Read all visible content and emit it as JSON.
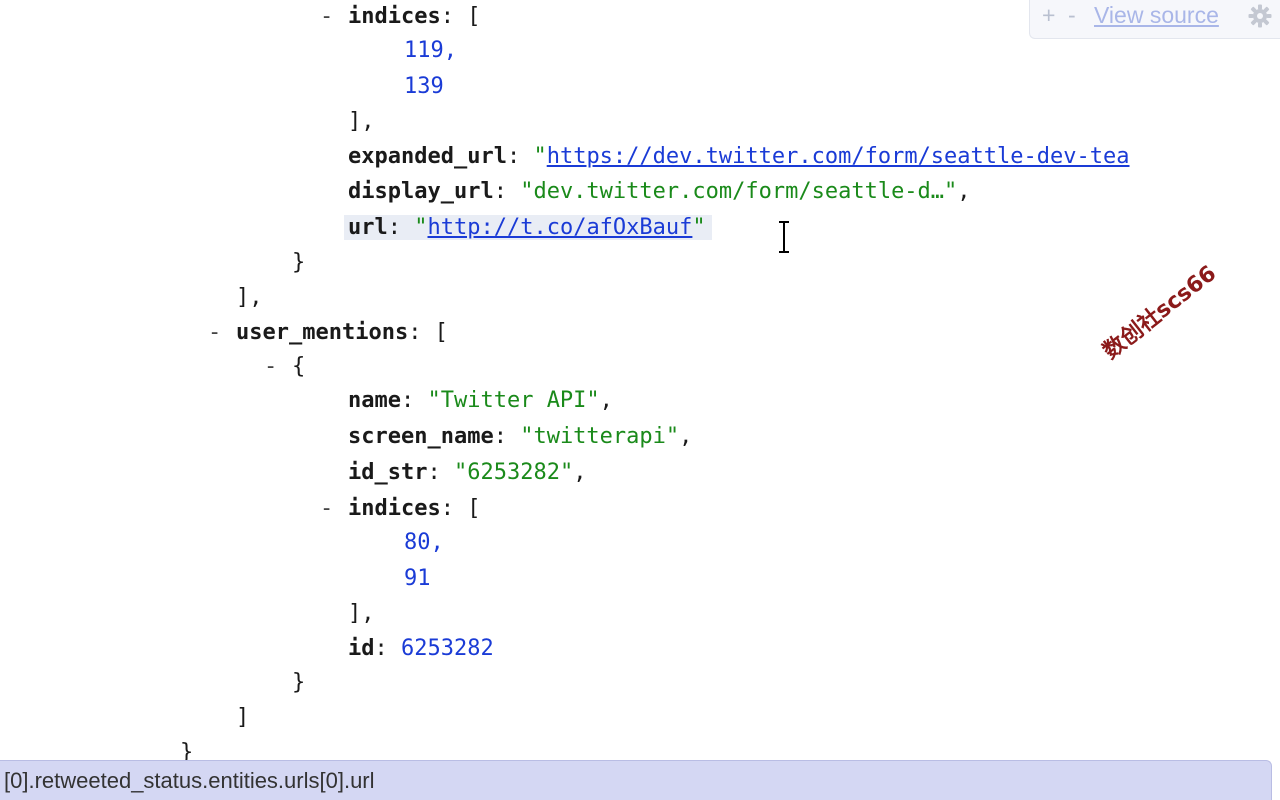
{
  "toolbar": {
    "expand_label": "+",
    "collapse_label": "-",
    "view_source_label": "View source",
    "settings_icon": "gear-icon"
  },
  "tree": {
    "indices1": {
      "toggle": "-",
      "key": "indices",
      "open": ": [",
      "values": [
        "119,",
        "139"
      ],
      "close": "],"
    },
    "expanded_url": {
      "key": "expanded_url",
      "sep": ": ",
      "quote_open": "\"",
      "value": "https://dev.twitter.com/form/seattle-dev-tea"
    },
    "display_url": {
      "key": "display_url",
      "sep": ": ",
      "value": "\"dev.twitter.com/form/seattle-d…\"",
      "trail": ","
    },
    "url": {
      "key": "url",
      "sep": ": ",
      "quote_open": "\"",
      "value": "http://t.co/afOxBauf",
      "quote_close": "\""
    },
    "obj_close1": "}",
    "arr_close1": "],",
    "user_mentions": {
      "toggle": "-",
      "key": "user_mentions",
      "open": ": ["
    },
    "obj_open2": {
      "toggle": "-",
      "brace": "{"
    },
    "name": {
      "key": "name",
      "sep": ": ",
      "value": "\"Twitter API\"",
      "trail": ","
    },
    "screen_name": {
      "key": "screen_name",
      "sep": ": ",
      "value": "\"twitterapi\"",
      "trail": ","
    },
    "id_str": {
      "key": "id_str",
      "sep": ": ",
      "value": "\"6253282\"",
      "trail": ","
    },
    "indices2": {
      "toggle": "-",
      "key": "indices",
      "open": ": [",
      "values": [
        "80,",
        "91"
      ],
      "close": "],"
    },
    "id": {
      "key": "id",
      "sep": ": ",
      "value": "6253282"
    },
    "obj_close2": "}",
    "arr_close2": "]",
    "partial_close": "}"
  },
  "watermark": "数创社scs66",
  "status_path": "[0].retweeted_status.entities.urls[0].url"
}
